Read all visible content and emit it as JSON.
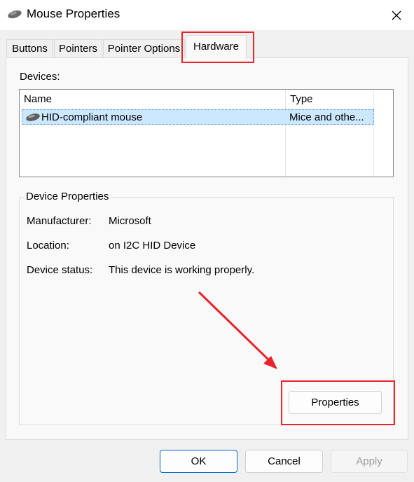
{
  "window": {
    "title": "Mouse Properties",
    "icon": "mouse-icon",
    "close_glyph": "✕"
  },
  "tabs": [
    {
      "label": "Buttons"
    },
    {
      "label": "Pointers"
    },
    {
      "label": "Pointer Options"
    },
    {
      "label": "Hardware",
      "selected": true
    }
  ],
  "devices": {
    "label": "Devices:",
    "columns": [
      "Name",
      "Type"
    ],
    "rows": [
      {
        "icon": "mouse-device-icon",
        "name": "HID-compliant mouse",
        "type": "Mice and othe...",
        "selected": true
      }
    ]
  },
  "device_properties": {
    "title": "Device Properties",
    "manufacturer_label": "Manufacturer:",
    "manufacturer_value": "Microsoft",
    "location_label": "Location:",
    "location_value": "on I2C HID Device",
    "status_label": "Device status:",
    "status_value": "This device is working properly.",
    "properties_button": "Properties"
  },
  "footer": {
    "ok": "OK",
    "cancel": "Cancel",
    "apply": "Apply",
    "apply_enabled": false
  },
  "annotations": {
    "highlight_color": "#e8232b"
  }
}
